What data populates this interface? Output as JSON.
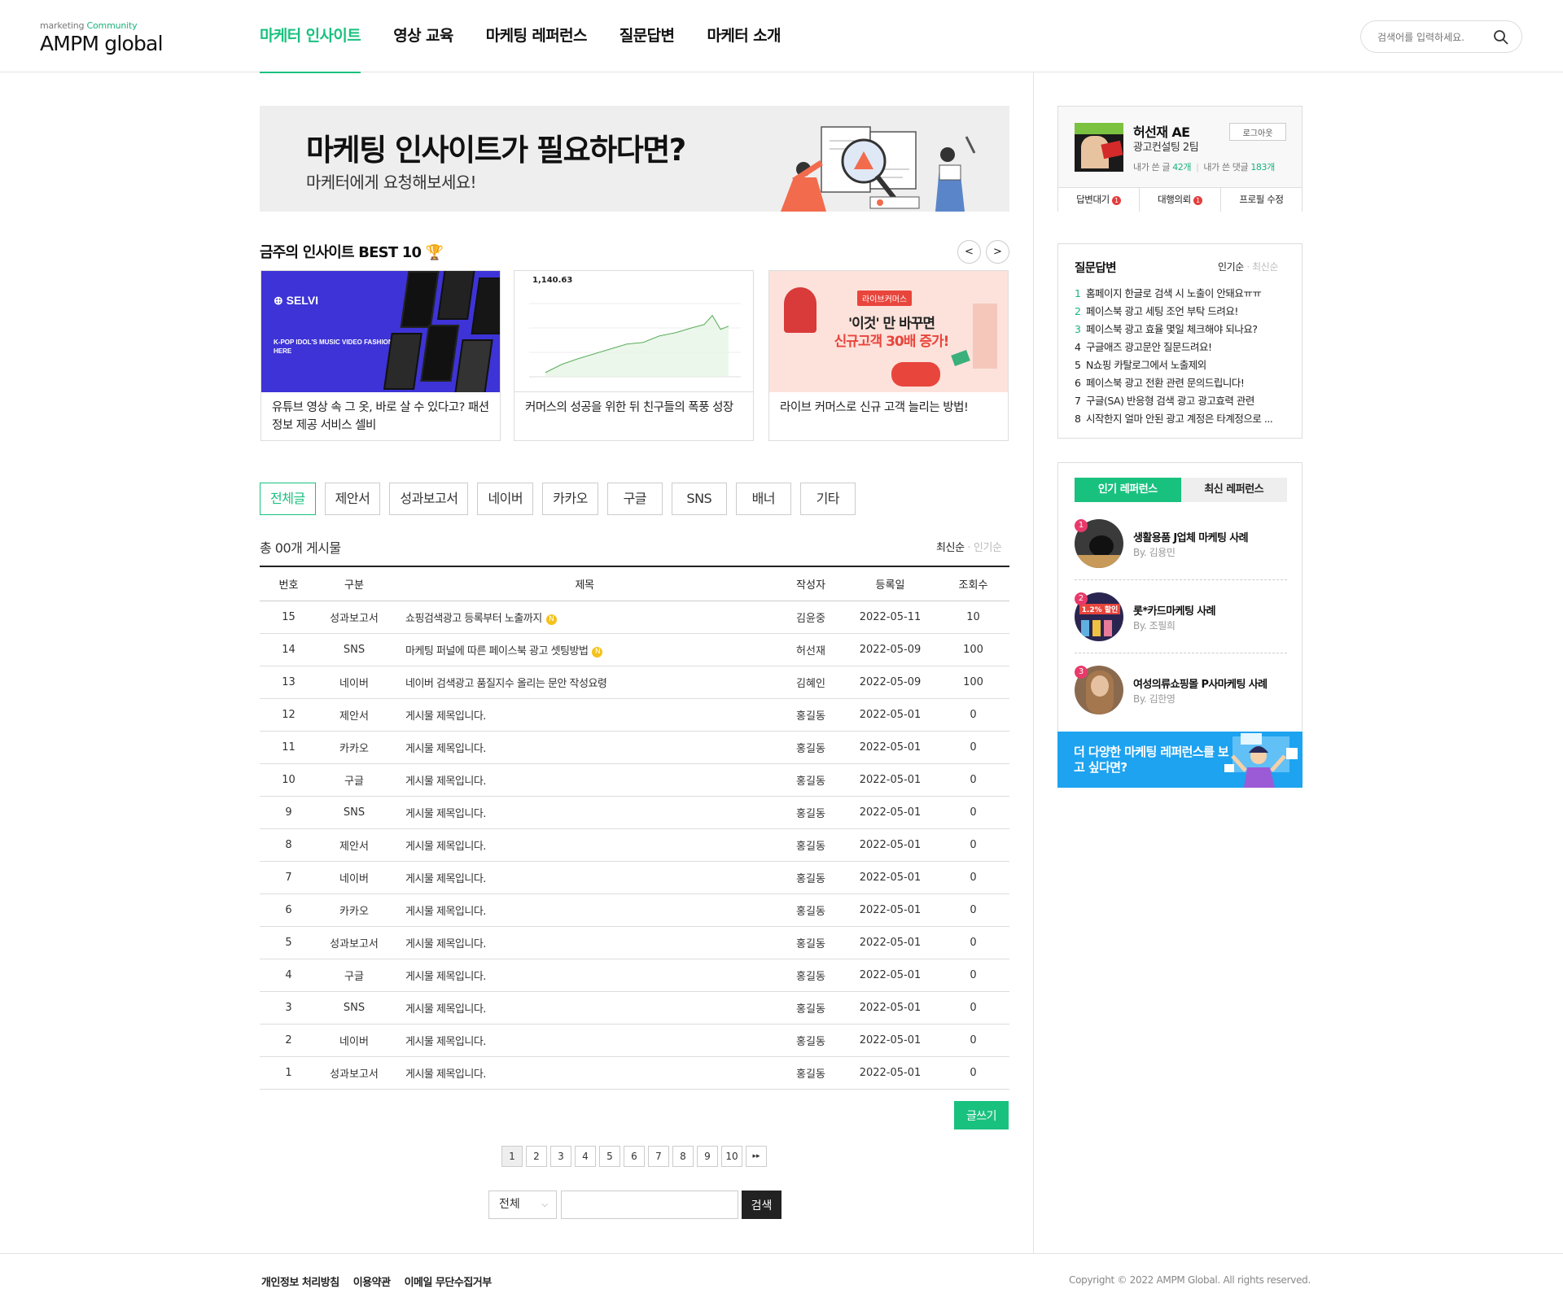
{
  "header": {
    "logo_small": "marketing",
    "logo_small_accent": "Community",
    "logo_main": "AMPM global",
    "nav": [
      {
        "label": "마케터 인사이트",
        "active": true
      },
      {
        "label": "영상 교육"
      },
      {
        "label": "마케팅 레퍼런스"
      },
      {
        "label": "질문답변"
      },
      {
        "label": "마케터 소개"
      }
    ],
    "search_placeholder": "검색어를 입력하세요."
  },
  "banner": {
    "title": "마케팅 인사이트가 필요하다면?",
    "subtitle": "마케터에게 요청해보세요!"
  },
  "best": {
    "title": "금주의 인사이트 BEST 10",
    "prev": "<",
    "next": ">",
    "cards": [
      {
        "text": "유튜브 영상 속 그 옷, 바로 살 수 있다고? 패션 정보 제공 서비스 셀비",
        "image_brand": "SELVI",
        "image_caption": "K-POP IDOL'S MUSIC VIDEO FASHION IS HERE"
      },
      {
        "text": "커머스의 성공을 위한 뒤 친구들의 폭풍 성장",
        "image_value": "1,140.63"
      },
      {
        "text": "라이브 커머스로 신규 고객 늘리는 방법!",
        "image_tag": "라이브커머스",
        "image_line1": "'이것' 만 바꾸면",
        "image_line2": "신규고객 30배 증가!"
      }
    ]
  },
  "tabs": [
    "전체글",
    "제안서",
    "성과보고서",
    "네이버",
    "카카오",
    "구글",
    "SNS",
    "배너",
    "기타"
  ],
  "list": {
    "total": "총 00개 게시물",
    "sort_latest": "최신순",
    "sort_popular": "인기순",
    "headers": {
      "no": "번호",
      "cat": "구분",
      "title": "제목",
      "writer": "작성자",
      "date": "등록일",
      "views": "조회수"
    },
    "rows": [
      {
        "no": "15",
        "cat": "성과보고서",
        "title": "쇼핑검색광고 등록부터 노출까지",
        "new": "N",
        "writer": "김윤중",
        "date": "2022-05-11",
        "views": "10"
      },
      {
        "no": "14",
        "cat": "SNS",
        "title": "마케팅 퍼널에 따른 페이스북 광고 셋팅방법",
        "new": "N",
        "writer": "허선재",
        "date": "2022-05-09",
        "views": "100"
      },
      {
        "no": "13",
        "cat": "네이버",
        "title": "네이버 검색광고 품질지수 올리는 문안 작성요령",
        "writer": "김혜인",
        "date": "2022-05-09",
        "views": "100"
      },
      {
        "no": "12",
        "cat": "제안서",
        "title": "게시물 제목입니다.",
        "writer": "홍길동",
        "date": "2022-05-01",
        "views": "0"
      },
      {
        "no": "11",
        "cat": "카카오",
        "title": "게시물 제목입니다.",
        "writer": "홍길동",
        "date": "2022-05-01",
        "views": "0"
      },
      {
        "no": "10",
        "cat": "구글",
        "title": "게시물 제목입니다.",
        "writer": "홍길동",
        "date": "2022-05-01",
        "views": "0"
      },
      {
        "no": "9",
        "cat": "SNS",
        "title": "게시물 제목입니다.",
        "writer": "홍길동",
        "date": "2022-05-01",
        "views": "0"
      },
      {
        "no": "8",
        "cat": "제안서",
        "title": "게시물 제목입니다.",
        "writer": "홍길동",
        "date": "2022-05-01",
        "views": "0"
      },
      {
        "no": "7",
        "cat": "네이버",
        "title": "게시물 제목입니다.",
        "writer": "홍길동",
        "date": "2022-05-01",
        "views": "0"
      },
      {
        "no": "6",
        "cat": "카카오",
        "title": "게시물 제목입니다.",
        "writer": "홍길동",
        "date": "2022-05-01",
        "views": "0"
      },
      {
        "no": "5",
        "cat": "성과보고서",
        "title": "게시물 제목입니다.",
        "writer": "홍길동",
        "date": "2022-05-01",
        "views": "0"
      },
      {
        "no": "4",
        "cat": "구글",
        "title": "게시물 제목입니다.",
        "writer": "홍길동",
        "date": "2022-05-01",
        "views": "0"
      },
      {
        "no": "3",
        "cat": "SNS",
        "title": "게시물 제목입니다.",
        "writer": "홍길동",
        "date": "2022-05-01",
        "views": "0"
      },
      {
        "no": "2",
        "cat": "네이버",
        "title": "게시물 제목입니다.",
        "writer": "홍길동",
        "date": "2022-05-01",
        "views": "0"
      },
      {
        "no": "1",
        "cat": "성과보고서",
        "title": "게시물 제목입니다.",
        "writer": "홍길동",
        "date": "2022-05-01",
        "views": "0"
      }
    ],
    "write_label": "글쓰기",
    "pages": [
      "1",
      "2",
      "3",
      "4",
      "5",
      "6",
      "7",
      "8",
      "9",
      "10"
    ],
    "current_page": "1",
    "next_label": "▸▸",
    "search_select": "전체",
    "search_button": "검색"
  },
  "footer": {
    "links": [
      "개인정보 처리방침",
      "이용약관",
      "이메일 무단수집거부"
    ],
    "copyright": "Copyright © 2022 AMPM Global. All rights reserved."
  },
  "profile": {
    "name": "허선재 AE",
    "team": "광고컨설팅 2팀",
    "logout": "로그아웃",
    "posts_label": "내가 쓴 글",
    "posts_count": "42개",
    "comments_label": "내가 쓴 댓글",
    "comments_count": "183개",
    "actions": [
      {
        "label": "답변대기",
        "badge": "1"
      },
      {
        "label": "대행의뢰",
        "badge": "1"
      },
      {
        "label": "프로필 수정"
      }
    ]
  },
  "qna": {
    "title": "질문답변",
    "sort_popular": "인기순",
    "sort_latest": "최신순",
    "items": [
      {
        "n": "1",
        "text": "홈페이지 한글로 검색 시 노출이 안돼요ㅠㅠ"
      },
      {
        "n": "2",
        "text": "페이스북 광고 세팅 조언 부탁 드려요!"
      },
      {
        "n": "3",
        "text": "페이스북 광고 효율 몇일 체크해야 되나요?"
      },
      {
        "n": "4",
        "text": "구글애즈 광고문안 질문드려요!"
      },
      {
        "n": "5",
        "text": "N쇼핑 카탈로그에서 노출제외"
      },
      {
        "n": "6",
        "text": "페이스북 광고 전환 관련 문의드립니다!"
      },
      {
        "n": "7",
        "text": "구글(SA) 반응형 검색 광고 광고효력 관련"
      },
      {
        "n": "8",
        "text": "시작한지 얼마 안된 광고 계정은 타계정으로 ..."
      }
    ]
  },
  "reference": {
    "tab_popular": "인기 레퍼런스",
    "tab_latest": "최신 레퍼런스",
    "items": [
      {
        "rank": "1",
        "title": "생활용품 J업체 마케팅 사례",
        "by": "By. 김용민"
      },
      {
        "rank": "2",
        "title": "롯*카드마케팅 사례",
        "by": "By. 조필희",
        "thumb_text": "1.2% 할인"
      },
      {
        "rank": "3",
        "title": "여성의류쇼핑몰 P사마케팅 사례",
        "by": "By. 김한영"
      }
    ],
    "banner_text": "더 다양한 마케팅 레퍼런스를 보고 싶다면?"
  },
  "colors": {
    "accent": "#19c17f",
    "banner_blue": "#1da3f0",
    "badge_red": "#e43d3d",
    "rank_pink": "#e83a6a"
  }
}
